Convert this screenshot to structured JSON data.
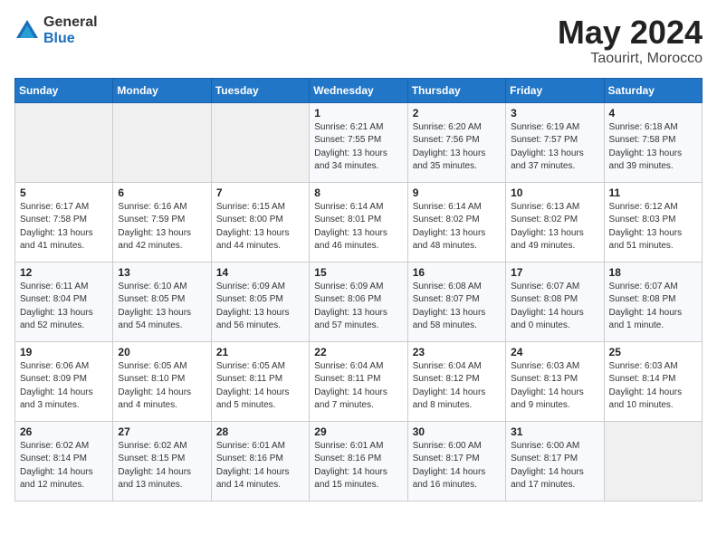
{
  "logo": {
    "general": "General",
    "blue": "Blue"
  },
  "title": {
    "month_year": "May 2024",
    "location": "Taourirt, Morocco"
  },
  "weekdays": [
    "Sunday",
    "Monday",
    "Tuesday",
    "Wednesday",
    "Thursday",
    "Friday",
    "Saturday"
  ],
  "weeks": [
    [
      {
        "day": "",
        "info": ""
      },
      {
        "day": "",
        "info": ""
      },
      {
        "day": "",
        "info": ""
      },
      {
        "day": "1",
        "info": "Sunrise: 6:21 AM\nSunset: 7:55 PM\nDaylight: 13 hours\nand 34 minutes."
      },
      {
        "day": "2",
        "info": "Sunrise: 6:20 AM\nSunset: 7:56 PM\nDaylight: 13 hours\nand 35 minutes."
      },
      {
        "day": "3",
        "info": "Sunrise: 6:19 AM\nSunset: 7:57 PM\nDaylight: 13 hours\nand 37 minutes."
      },
      {
        "day": "4",
        "info": "Sunrise: 6:18 AM\nSunset: 7:58 PM\nDaylight: 13 hours\nand 39 minutes."
      }
    ],
    [
      {
        "day": "5",
        "info": "Sunrise: 6:17 AM\nSunset: 7:58 PM\nDaylight: 13 hours\nand 41 minutes."
      },
      {
        "day": "6",
        "info": "Sunrise: 6:16 AM\nSunset: 7:59 PM\nDaylight: 13 hours\nand 42 minutes."
      },
      {
        "day": "7",
        "info": "Sunrise: 6:15 AM\nSunset: 8:00 PM\nDaylight: 13 hours\nand 44 minutes."
      },
      {
        "day": "8",
        "info": "Sunrise: 6:14 AM\nSunset: 8:01 PM\nDaylight: 13 hours\nand 46 minutes."
      },
      {
        "day": "9",
        "info": "Sunrise: 6:14 AM\nSunset: 8:02 PM\nDaylight: 13 hours\nand 48 minutes."
      },
      {
        "day": "10",
        "info": "Sunrise: 6:13 AM\nSunset: 8:02 PM\nDaylight: 13 hours\nand 49 minutes."
      },
      {
        "day": "11",
        "info": "Sunrise: 6:12 AM\nSunset: 8:03 PM\nDaylight: 13 hours\nand 51 minutes."
      }
    ],
    [
      {
        "day": "12",
        "info": "Sunrise: 6:11 AM\nSunset: 8:04 PM\nDaylight: 13 hours\nand 52 minutes."
      },
      {
        "day": "13",
        "info": "Sunrise: 6:10 AM\nSunset: 8:05 PM\nDaylight: 13 hours\nand 54 minutes."
      },
      {
        "day": "14",
        "info": "Sunrise: 6:09 AM\nSunset: 8:05 PM\nDaylight: 13 hours\nand 56 minutes."
      },
      {
        "day": "15",
        "info": "Sunrise: 6:09 AM\nSunset: 8:06 PM\nDaylight: 13 hours\nand 57 minutes."
      },
      {
        "day": "16",
        "info": "Sunrise: 6:08 AM\nSunset: 8:07 PM\nDaylight: 13 hours\nand 58 minutes."
      },
      {
        "day": "17",
        "info": "Sunrise: 6:07 AM\nSunset: 8:08 PM\nDaylight: 14 hours\nand 0 minutes."
      },
      {
        "day": "18",
        "info": "Sunrise: 6:07 AM\nSunset: 8:08 PM\nDaylight: 14 hours\nand 1 minute."
      }
    ],
    [
      {
        "day": "19",
        "info": "Sunrise: 6:06 AM\nSunset: 8:09 PM\nDaylight: 14 hours\nand 3 minutes."
      },
      {
        "day": "20",
        "info": "Sunrise: 6:05 AM\nSunset: 8:10 PM\nDaylight: 14 hours\nand 4 minutes."
      },
      {
        "day": "21",
        "info": "Sunrise: 6:05 AM\nSunset: 8:11 PM\nDaylight: 14 hours\nand 5 minutes."
      },
      {
        "day": "22",
        "info": "Sunrise: 6:04 AM\nSunset: 8:11 PM\nDaylight: 14 hours\nand 7 minutes."
      },
      {
        "day": "23",
        "info": "Sunrise: 6:04 AM\nSunset: 8:12 PM\nDaylight: 14 hours\nand 8 minutes."
      },
      {
        "day": "24",
        "info": "Sunrise: 6:03 AM\nSunset: 8:13 PM\nDaylight: 14 hours\nand 9 minutes."
      },
      {
        "day": "25",
        "info": "Sunrise: 6:03 AM\nSunset: 8:14 PM\nDaylight: 14 hours\nand 10 minutes."
      }
    ],
    [
      {
        "day": "26",
        "info": "Sunrise: 6:02 AM\nSunset: 8:14 PM\nDaylight: 14 hours\nand 12 minutes."
      },
      {
        "day": "27",
        "info": "Sunrise: 6:02 AM\nSunset: 8:15 PM\nDaylight: 14 hours\nand 13 minutes."
      },
      {
        "day": "28",
        "info": "Sunrise: 6:01 AM\nSunset: 8:16 PM\nDaylight: 14 hours\nand 14 minutes."
      },
      {
        "day": "29",
        "info": "Sunrise: 6:01 AM\nSunset: 8:16 PM\nDaylight: 14 hours\nand 15 minutes."
      },
      {
        "day": "30",
        "info": "Sunrise: 6:00 AM\nSunset: 8:17 PM\nDaylight: 14 hours\nand 16 minutes."
      },
      {
        "day": "31",
        "info": "Sunrise: 6:00 AM\nSunset: 8:17 PM\nDaylight: 14 hours\nand 17 minutes."
      },
      {
        "day": "",
        "info": ""
      }
    ]
  ]
}
